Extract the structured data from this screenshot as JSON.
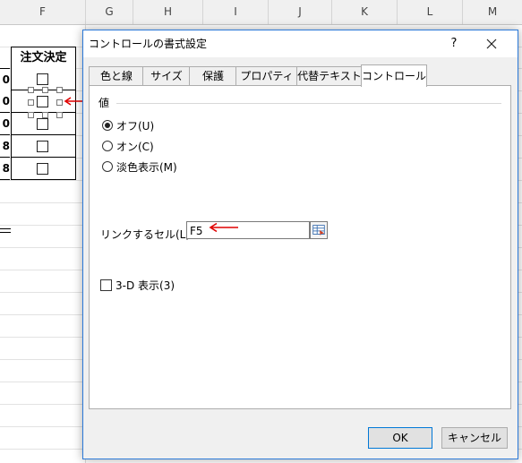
{
  "sheet": {
    "columns": [
      "F",
      "G",
      "H",
      "I",
      "J",
      "K",
      "L",
      "M"
    ],
    "header_cell": "注文決定",
    "left_values": [
      "0",
      "0",
      "0",
      "8",
      "8"
    ]
  },
  "dialog": {
    "title": "コントロールの書式設定",
    "help": "?",
    "tabs": [
      "色と線",
      "サイズ",
      "保護",
      "プロパティ",
      "代替テキスト",
      "コントロール"
    ],
    "active_tab": "コントロール",
    "group_label": "値",
    "radio_options": [
      "オフ(U)",
      "オン(C)",
      "淡色表示(M)"
    ],
    "selected_radio": "オフ(U)",
    "link_label": "リンクするセル(L):",
    "link_value": "F5",
    "checkbox_3d": "3-D 表示(3)",
    "ok": "OK",
    "cancel": "キャンセル"
  },
  "colors": {
    "accent": "#2b79d8",
    "annotation_arrow": "#e00000"
  }
}
